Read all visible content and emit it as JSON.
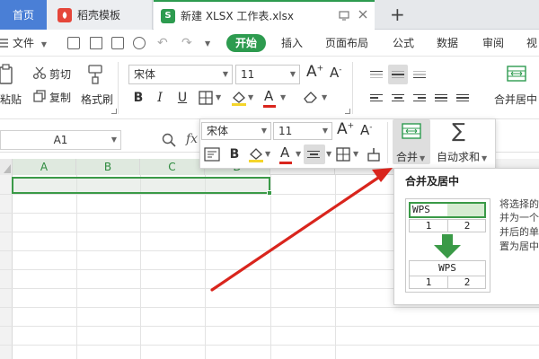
{
  "tabs": {
    "home": "首页",
    "templates": "稻壳模板",
    "file": "新建 XLSX 工作表.xlsx",
    "add": "+"
  },
  "menu": {
    "file": "文件",
    "start": "开始",
    "insert": "插入",
    "layout": "页面布局",
    "formula": "公式",
    "data": "数据",
    "review": "审阅",
    "view": "视"
  },
  "ribbon": {
    "paste": "粘贴",
    "cut": "剪切",
    "copy": "复制",
    "format_painter": "格式刷",
    "font_name": "宋体",
    "font_size": "11",
    "bold": "B",
    "italic": "I",
    "underline": "U",
    "font_color_letter": "A",
    "grow_font": "A",
    "shrink_font": "A",
    "merge_center": "合并居中"
  },
  "formula_bar": {
    "cell_ref": "A1",
    "fx": "fx"
  },
  "columns": [
    "A",
    "B",
    "C",
    "D"
  ],
  "mini_toolbar": {
    "font_name": "宋体",
    "font_size": "11",
    "bold": "B",
    "font_color_letter": "A",
    "grow_font": "A",
    "shrink_font": "A",
    "merge": "合并",
    "autosum": "自动求和",
    "sigma": "∑"
  },
  "tooltip": {
    "title": "合并及居中",
    "desc_lines": [
      "将选择的",
      "并为一个",
      "并后的单",
      "置为居中"
    ],
    "demo_before": [
      "WPS",
      "1",
      "2"
    ],
    "demo_after": [
      "WPS",
      "1",
      "2"
    ]
  },
  "colors": {
    "accent_green": "#2d9b4f",
    "arrow_red": "#d9251d",
    "home_blue": "#4a7fd6"
  }
}
